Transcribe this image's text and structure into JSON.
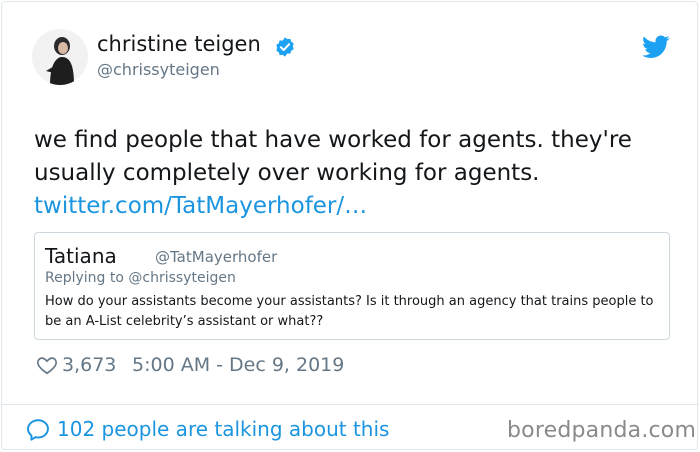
{
  "author": {
    "display_name": "christine teigen",
    "handle": "@chrissyteigen",
    "verified": true
  },
  "tweet": {
    "text": "we find people that have worked for agents. they're usually completely over working for agents.",
    "link": "twitter.com/TatMayerhofer/…"
  },
  "quoted_tweet": {
    "name": "Tatiana",
    "handle": "@TatMayerhofer",
    "replying_to": "Replying to @chrissyteigen",
    "text": "How do your assistants become your assistants? Is it through an agency that trains people to be an A-List celebrity’s assistant or what??"
  },
  "meta": {
    "like_count": "3,673",
    "timestamp": "5:00 AM - Dec 9, 2019"
  },
  "footer": {
    "talking_label": "102 people are talking about this",
    "watermark": "boredpanda.com"
  },
  "colors": {
    "link": "#1b95e0",
    "muted": "#657786",
    "border": "#e1e8ed",
    "verified": "#1da1f2"
  },
  "icons": [
    "verified-badge-icon",
    "twitter-bird-icon",
    "heart-icon",
    "speech-bubble-icon"
  ]
}
